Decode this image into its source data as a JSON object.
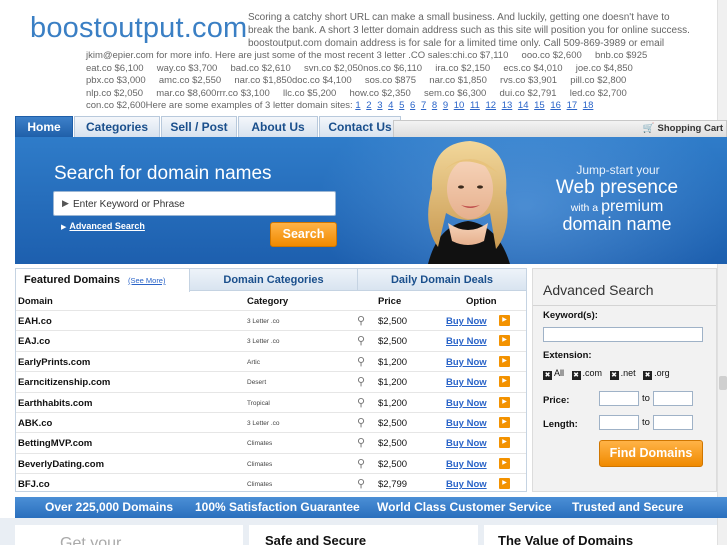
{
  "header": {
    "logo": "boostoutput.com",
    "intro": "Scoring a catchy short URL can make a small business. And luckily, getting one doesn't have to break the bank. A short 3 letter domain address such as this site will position you for online success. boostoutput.com domain address is for sale for a limited time only. Call 509-869-3989 or email",
    "sales_lines": [
      "jkim@epier.com for more info. Here are just some of the most recent 3 letter .CO sales:chi.co $7,110     ooo.co $2,600     bnb.co $925",
      "eat.co $6,100     way.co $3,700     bad.co $2,610     svn.co $2,050nos.co $6,110     ira.co $2,150     ecs.co $4,010     joe.co $4,850",
      "pbx.co $3,000     amc.co $2,550     nar.co $1,850doc.co $4,100     sos.co $875     nar.co $1,850     rvs.co $3,901     pill.co $2,800",
      "nlp.co $2,050     mar.co $8,600rrr.co $3,100     llc.co $5,200     how.co $2,350     sem.co $6,300     dui.co $2,791     led.co $2,700"
    ],
    "examples_prefix": "con.co $2,600Here are some examples of 3 letter domain sites:",
    "page_links": [
      "1",
      "2",
      "3",
      "4",
      "5",
      "6",
      "7",
      "8",
      "9",
      "10",
      "11",
      "12",
      "13",
      "14",
      "15",
      "16",
      "17",
      "18"
    ]
  },
  "nav": {
    "tabs": [
      "Home",
      "Categories",
      "Sell / Post",
      "About Us",
      "Contact Us"
    ],
    "active": "Home",
    "cart": "Shopping Cart"
  },
  "hero": {
    "search_title": "Search for domain names",
    "search_placeholder": "Enter Keyword or Phrase",
    "advanced_link": "Advanced Search",
    "search_button": "Search",
    "tagline_1": "Jump-start your",
    "tagline_2": "Web presence",
    "tagline_3a": "with a ",
    "tagline_3b": "premium",
    "tagline_4": "domain name"
  },
  "domains": {
    "tabs": {
      "featured": "Featured Domains",
      "see_more": "(See More)",
      "categories": "Domain Categories",
      "deals": "Daily Domain Deals"
    },
    "columns": {
      "domain": "Domain",
      "category": "Category",
      "price": "Price",
      "option": "Option"
    },
    "buy_label": "Buy Now",
    "rows": [
      {
        "domain": "EAH.co",
        "category": "3 Letter .co",
        "price": "$2,500"
      },
      {
        "domain": "EAJ.co",
        "category": "3 Letter .co",
        "price": "$2,500"
      },
      {
        "domain": "EarlyPrints.com",
        "category": "Artic",
        "price": "$1,200"
      },
      {
        "domain": "Earncitizenship.com",
        "category": "Desert",
        "price": "$1,200"
      },
      {
        "domain": "Earthhabits.com",
        "category": "Tropical",
        "price": "$1,200"
      },
      {
        "domain": "ABK.co",
        "category": "3 Letter .co",
        "price": "$2,500"
      },
      {
        "domain": "BettingMVP.com",
        "category": "Climates",
        "price": "$2,500"
      },
      {
        "domain": "BeverlyDating.com",
        "category": "Climates",
        "price": "$2,500"
      },
      {
        "domain": "BFJ.co",
        "category": "Climates",
        "price": "$2,799"
      }
    ]
  },
  "advanced_search": {
    "title": "Advanced Search",
    "keyword_label": "Keyword(s):",
    "extension_label": "Extension:",
    "ext_all": "All",
    "ext_com": ".com",
    "ext_net": ".net",
    "ext_org": ".org",
    "price_label": "Price:",
    "length_label": "Length:",
    "to": "to",
    "find_button": "Find Domains"
  },
  "bar": [
    "Over 225,000 Domains",
    "100% Satisfaction Guarantee",
    "World Class Customer Service",
    "Trusted and Secure"
  ],
  "bottom": {
    "col1": "Get your",
    "col2": "Safe and Secure",
    "col3": "The Value of Domains"
  },
  "colors": {
    "brand_blue": "#3a7fc4",
    "accent_orange": "#f39200",
    "link": "#2a64c8"
  }
}
